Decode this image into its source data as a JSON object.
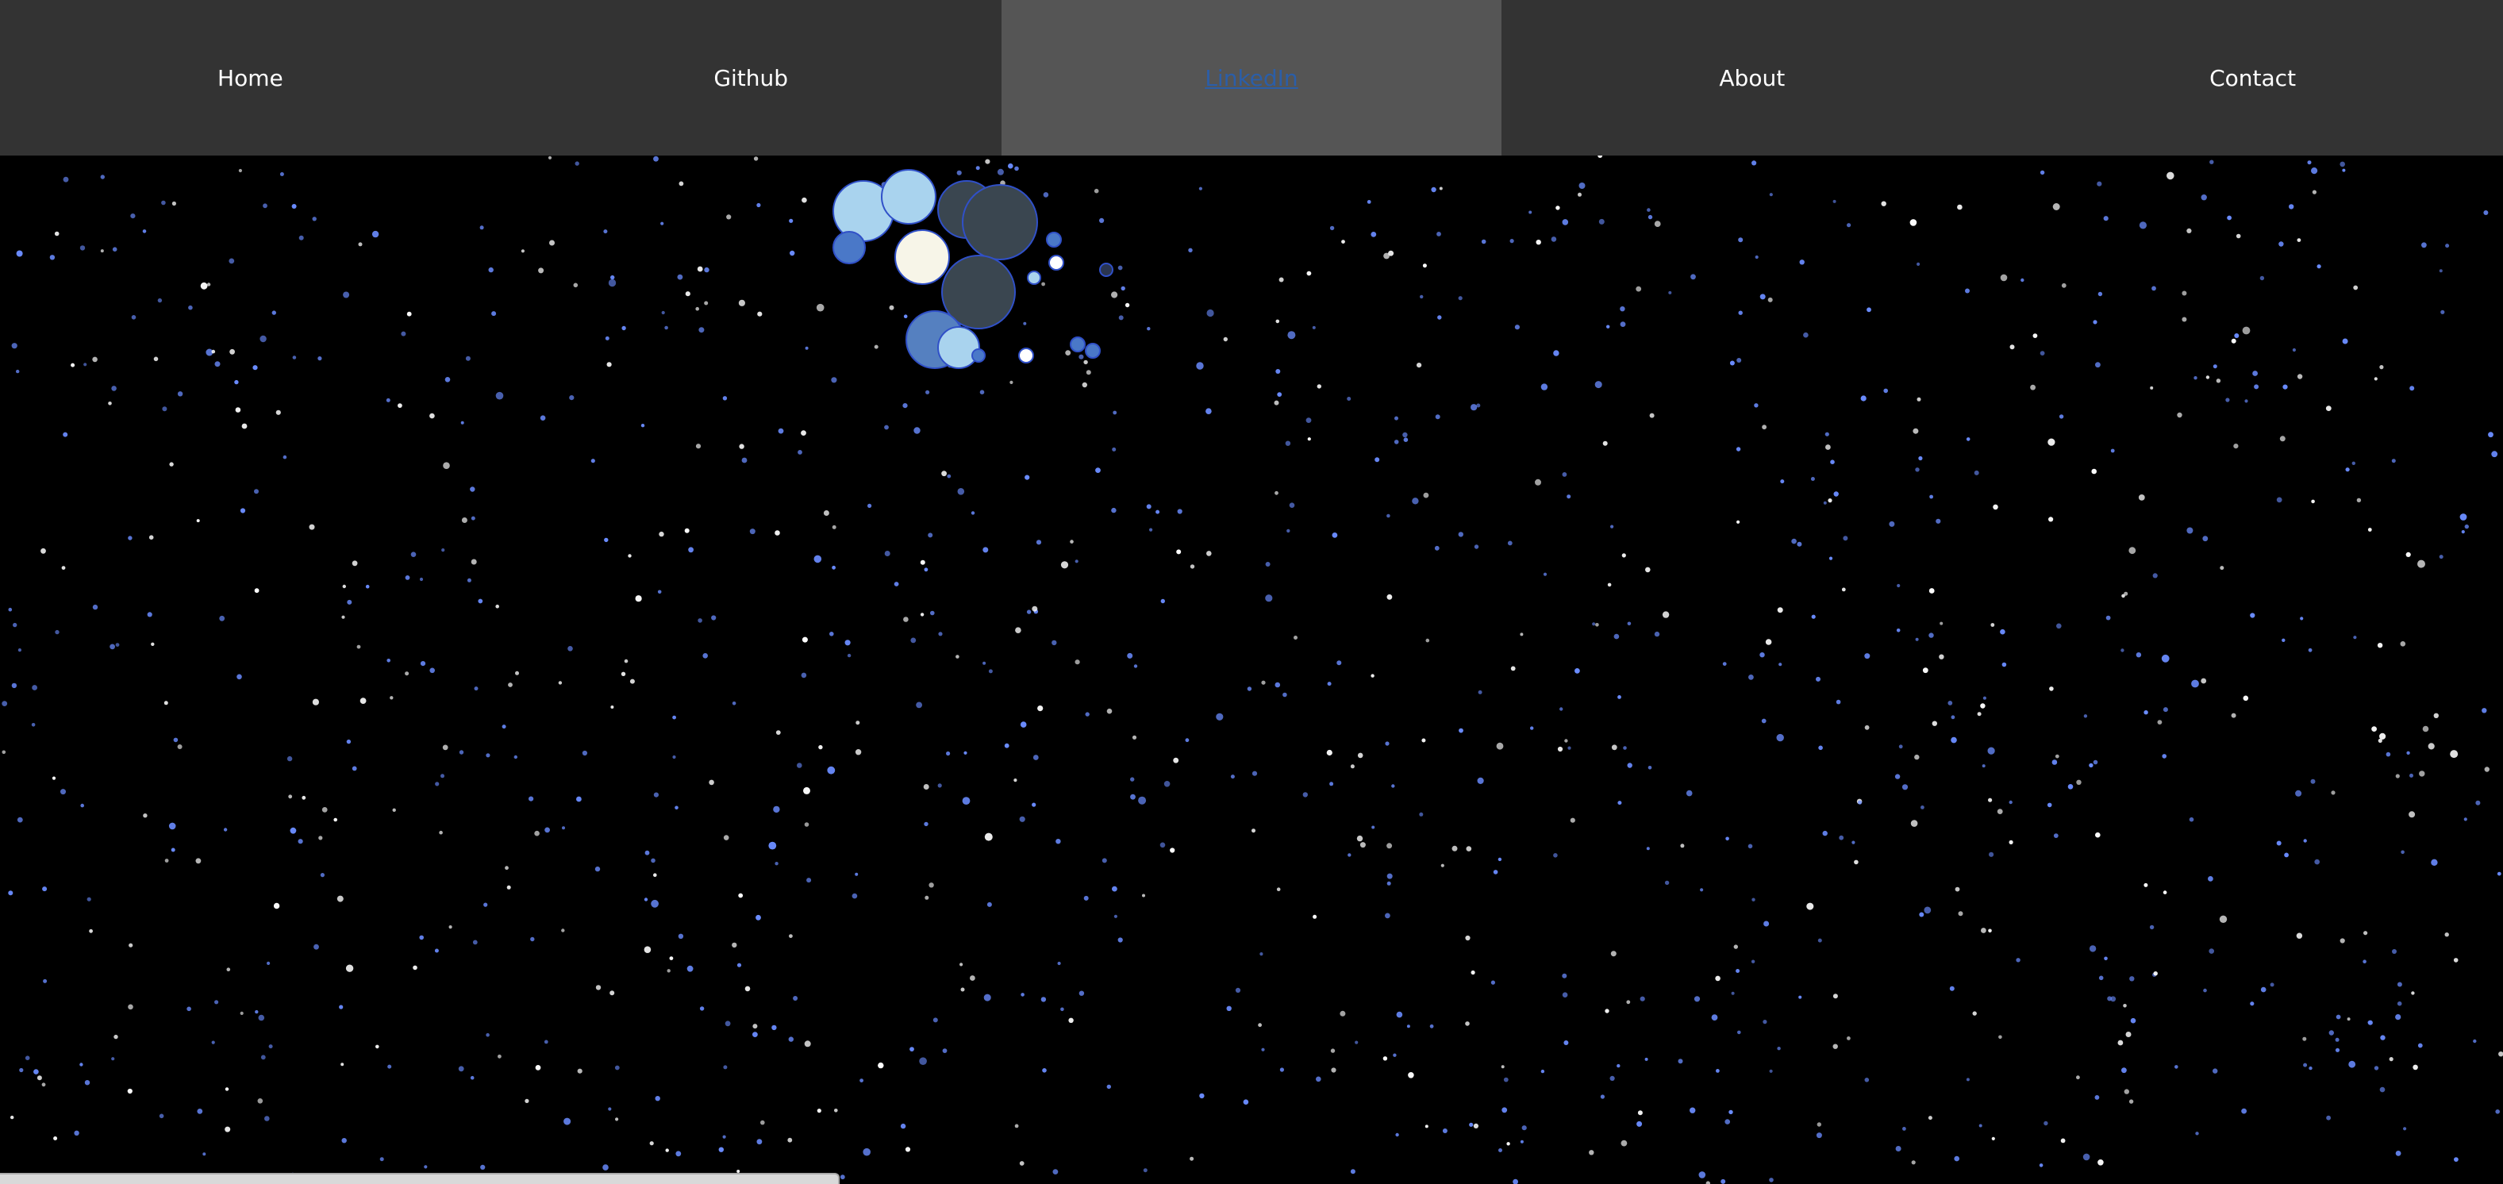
{
  "nav": {
    "items": [
      {
        "label": "Home",
        "active": false
      },
      {
        "label": "Github",
        "active": false
      },
      {
        "label": "LinkedIn",
        "active": true
      },
      {
        "label": "About",
        "active": false
      },
      {
        "label": "Contact",
        "active": false
      }
    ]
  },
  "colors": {
    "nav_bg": "#333333",
    "nav_active_bg": "#555555",
    "nav_text": "#ffffff",
    "nav_active_link": "#2b5ea8",
    "background": "#000000",
    "star_white": "#ffffff",
    "star_blue": "#6a8cff"
  }
}
